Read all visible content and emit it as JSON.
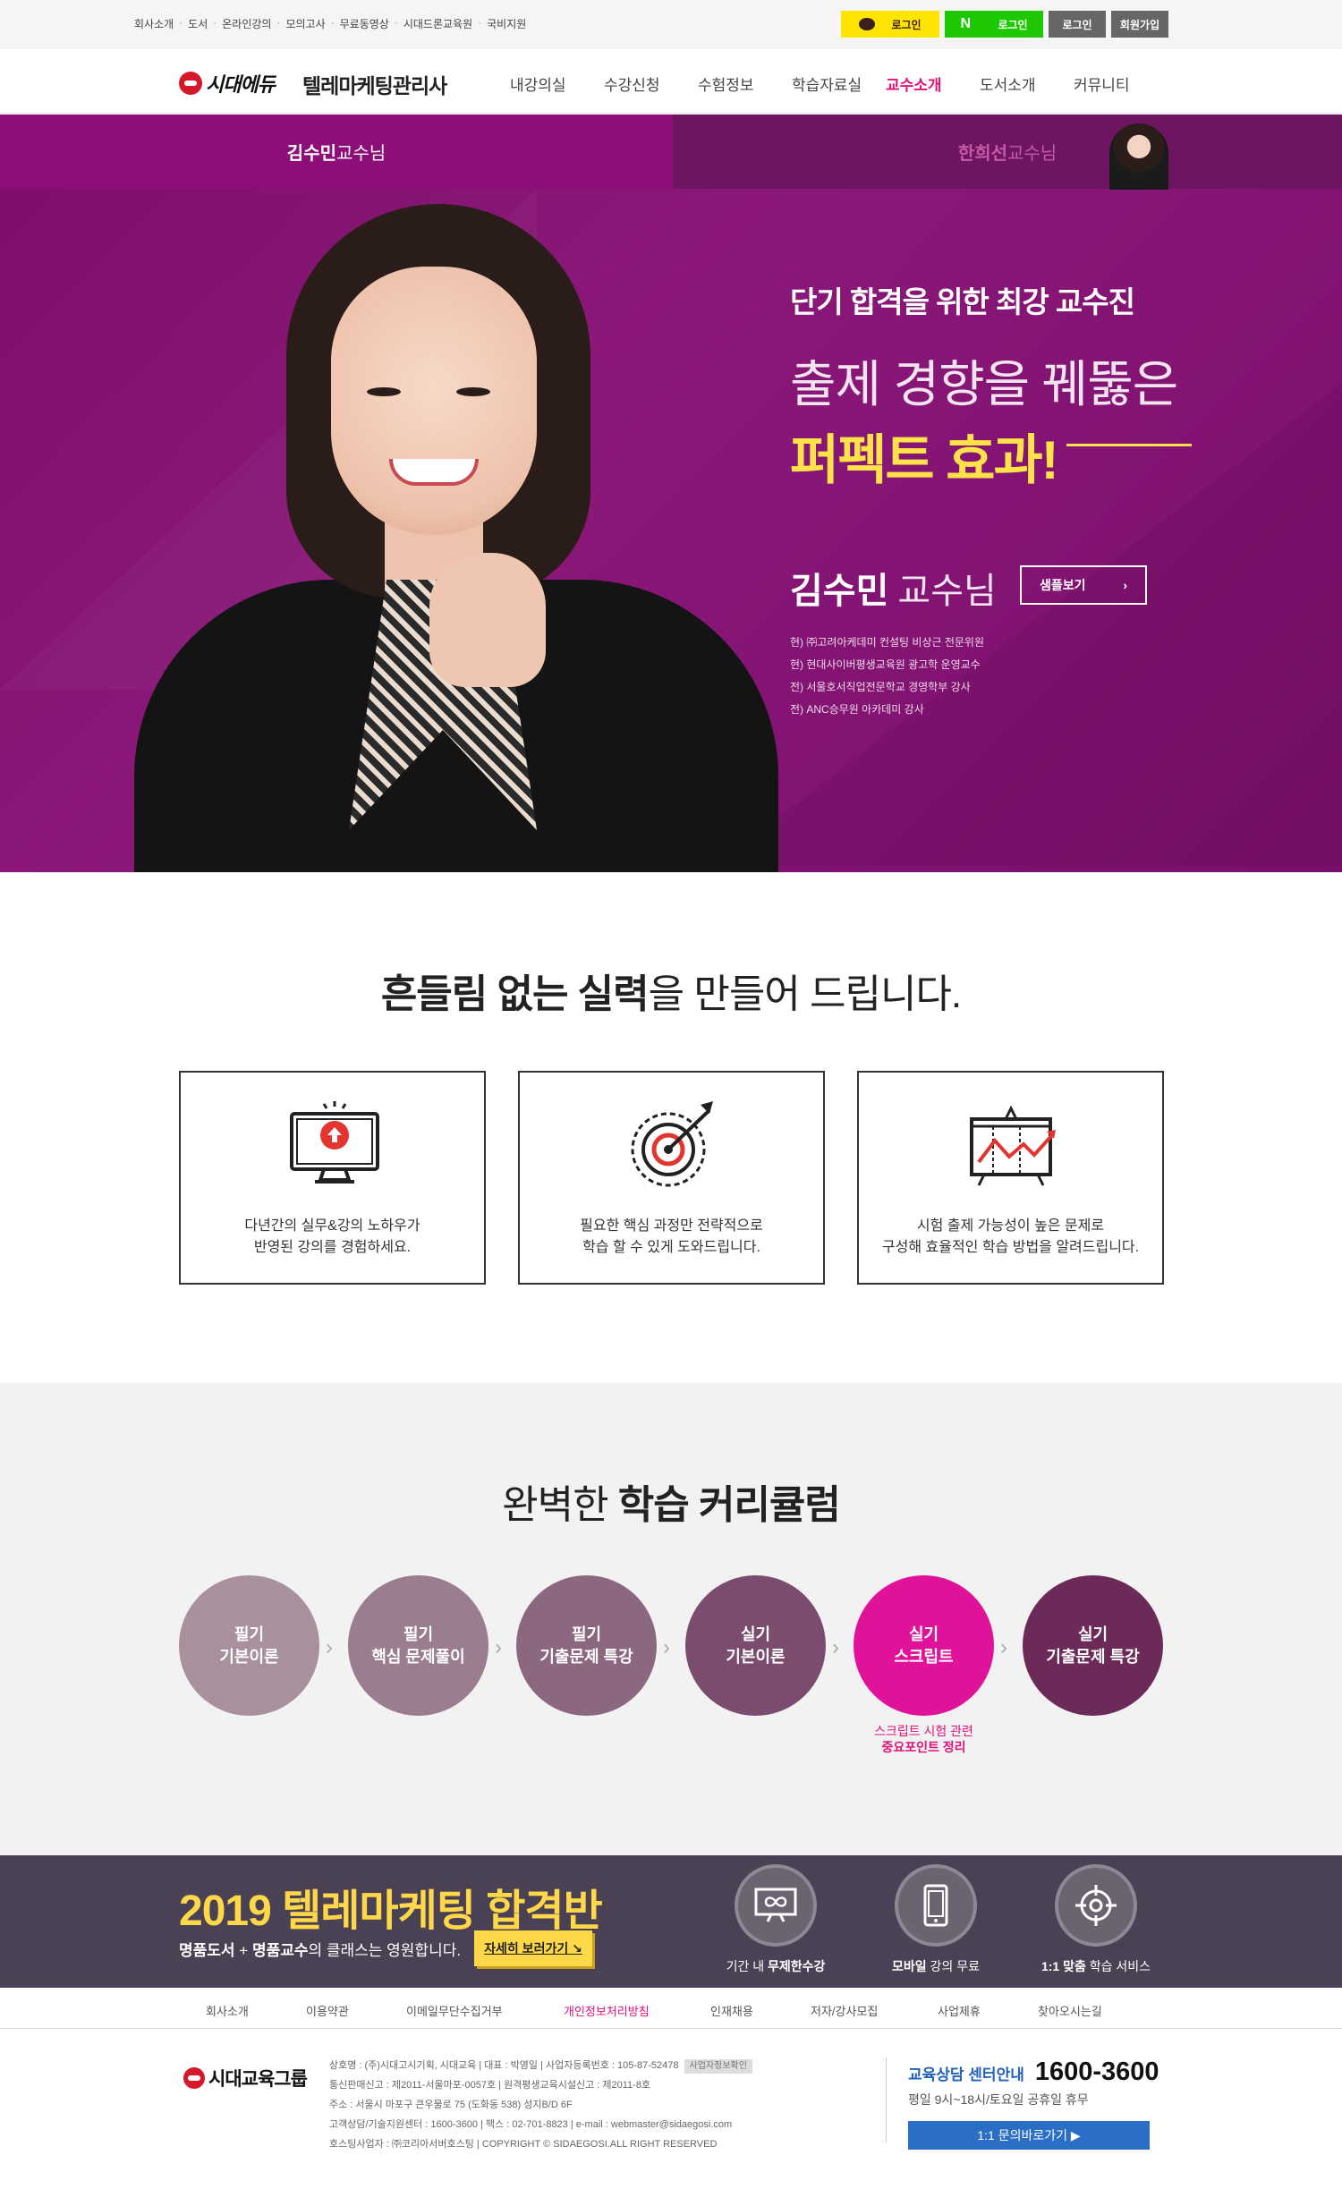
{
  "util": {
    "links": [
      "회사소개",
      "도서",
      "온라인강의",
      "모의고사",
      "무료동영상",
      "시대드론교육원",
      "국비지원"
    ],
    "kakao_login": "로그인",
    "naver_login": "로그인",
    "login": "로그인",
    "join": "회원가입"
  },
  "header": {
    "logo": "시대에듀",
    "site_name": "텔레마케팅관리사",
    "menu": [
      "내강의실",
      "수강신청",
      "수험정보",
      "학습자료실",
      "교수소개",
      "도서소개",
      "커뮤니티"
    ],
    "active_menu": "교수소개"
  },
  "hero": {
    "tab1_name": "김수민",
    "tab1_suffix": " 교수님",
    "tab2_name": "한희선",
    "tab2_suffix": " 교수님",
    "headline": "단기 합격을 위한 최강 교수진",
    "line2": "출제 경향을 꿰뚫은",
    "line3": "퍼펙트 효과!",
    "prof_name": "김수민",
    "prof_title": "교수님",
    "sample_btn": "샘플보기",
    "career": [
      "현) ㈜고려아케데미 컨설팅 비상근 전문위원",
      "현) 현대사이버평생교육원 광고학 운영교수",
      "전) 서울호서직업전문학교 경영학부 강사",
      "전) ANC승무원 아카데미 강사"
    ]
  },
  "features": {
    "title_bold1": "흔들림 없는 실력",
    "title_rest": "을 만들어 드립니다.",
    "items": [
      {
        "line1": "다년간의 실무&강의 노하우가",
        "line2": "반영된 강의를 경험하세요."
      },
      {
        "line1": "필요한 핵심 과정만 전략적으로",
        "line2": "학습 할 수 있게 도와드립니다."
      },
      {
        "line1": "시험 출제 가능성이 높은 문제로",
        "line2": "구성해 효율적인 학습 방법을 알려드립니다."
      }
    ]
  },
  "curriculum": {
    "title_light": "완벽한 ",
    "title_bold": "학습 커리큘럼",
    "steps": [
      {
        "l1": "필기",
        "l2": "기본이론",
        "color": "#a8909c"
      },
      {
        "l1": "필기",
        "l2": "핵심 문제풀이",
        "color": "#9a7d8e"
      },
      {
        "l1": "필기",
        "l2": "기출문제 특강",
        "color": "#8c6880"
      },
      {
        "l1": "실기",
        "l2": "기본이론",
        "color": "#7b4c6e"
      },
      {
        "l1": "실기",
        "l2": "스크립트",
        "color": "#e0129a"
      },
      {
        "l1": "실기",
        "l2": "기출문제 특강",
        "color": "#6c2a58"
      }
    ],
    "note_l1": "스크립트 시험 관련",
    "note_l2": "중요포인트 정리"
  },
  "banner": {
    "title": "2019 텔레마케팅 합격반",
    "sub_bold1": "명품도서",
    "sub_mid": " + ",
    "sub_bold2": "명품교수",
    "sub_rest": "의 클래스는 영원합니다.",
    "btn": "자세히 보러가기 ↘",
    "services": [
      {
        "pre": "기간 내 ",
        "bold": "무제한수강",
        "post": "",
        "icon": "infinity-monitor-icon"
      },
      {
        "pre": "",
        "bold": "모바일",
        "post": " 강의 무료",
        "icon": "mobile-icon"
      },
      {
        "pre": "",
        "bold": "1:1 맞춤",
        "post": " 학습 서비스",
        "icon": "target-icon"
      }
    ]
  },
  "footer": {
    "nav": [
      "회사소개",
      "이용약관",
      "이메일무단수집거부",
      "개인정보처리방침",
      "인재채용",
      "저자/강사모집",
      "사업제휴",
      "찾아오시는길"
    ],
    "logo": "시대교육그룹",
    "info": [
      "상호명 : (주)시대고시기획, 시대교육 | 대표 : 박영일 | 사업자등록번호 : 105-87-52478",
      "통신판매신고 : 제2011-서울마포-0057호 | 원격평생교육시설신고 : 제2011-8호",
      "주소 : 서울시 마포구 큰우물로 75 (도화동 538) 성지B/D 6F",
      "고객상담/기술지원센터 : 1600-3600 | 팩스 : 02-701-8823 | e-mail : webmaster@sidaegosi.com",
      "호스팅사업자 : ㈜코리아서버호스팅 | COPYRIGHT © SIDAEGOSI.ALL RIGHT RESERVED"
    ],
    "info_tag": "사업자정보확인",
    "call_label": "교육상담 센터안내",
    "call_number": "1600-3600",
    "hours": "평일 9시~18시/토요일 공휴일 휴무",
    "inquiry_btn": "1:1 문의바로가기 ▶"
  }
}
